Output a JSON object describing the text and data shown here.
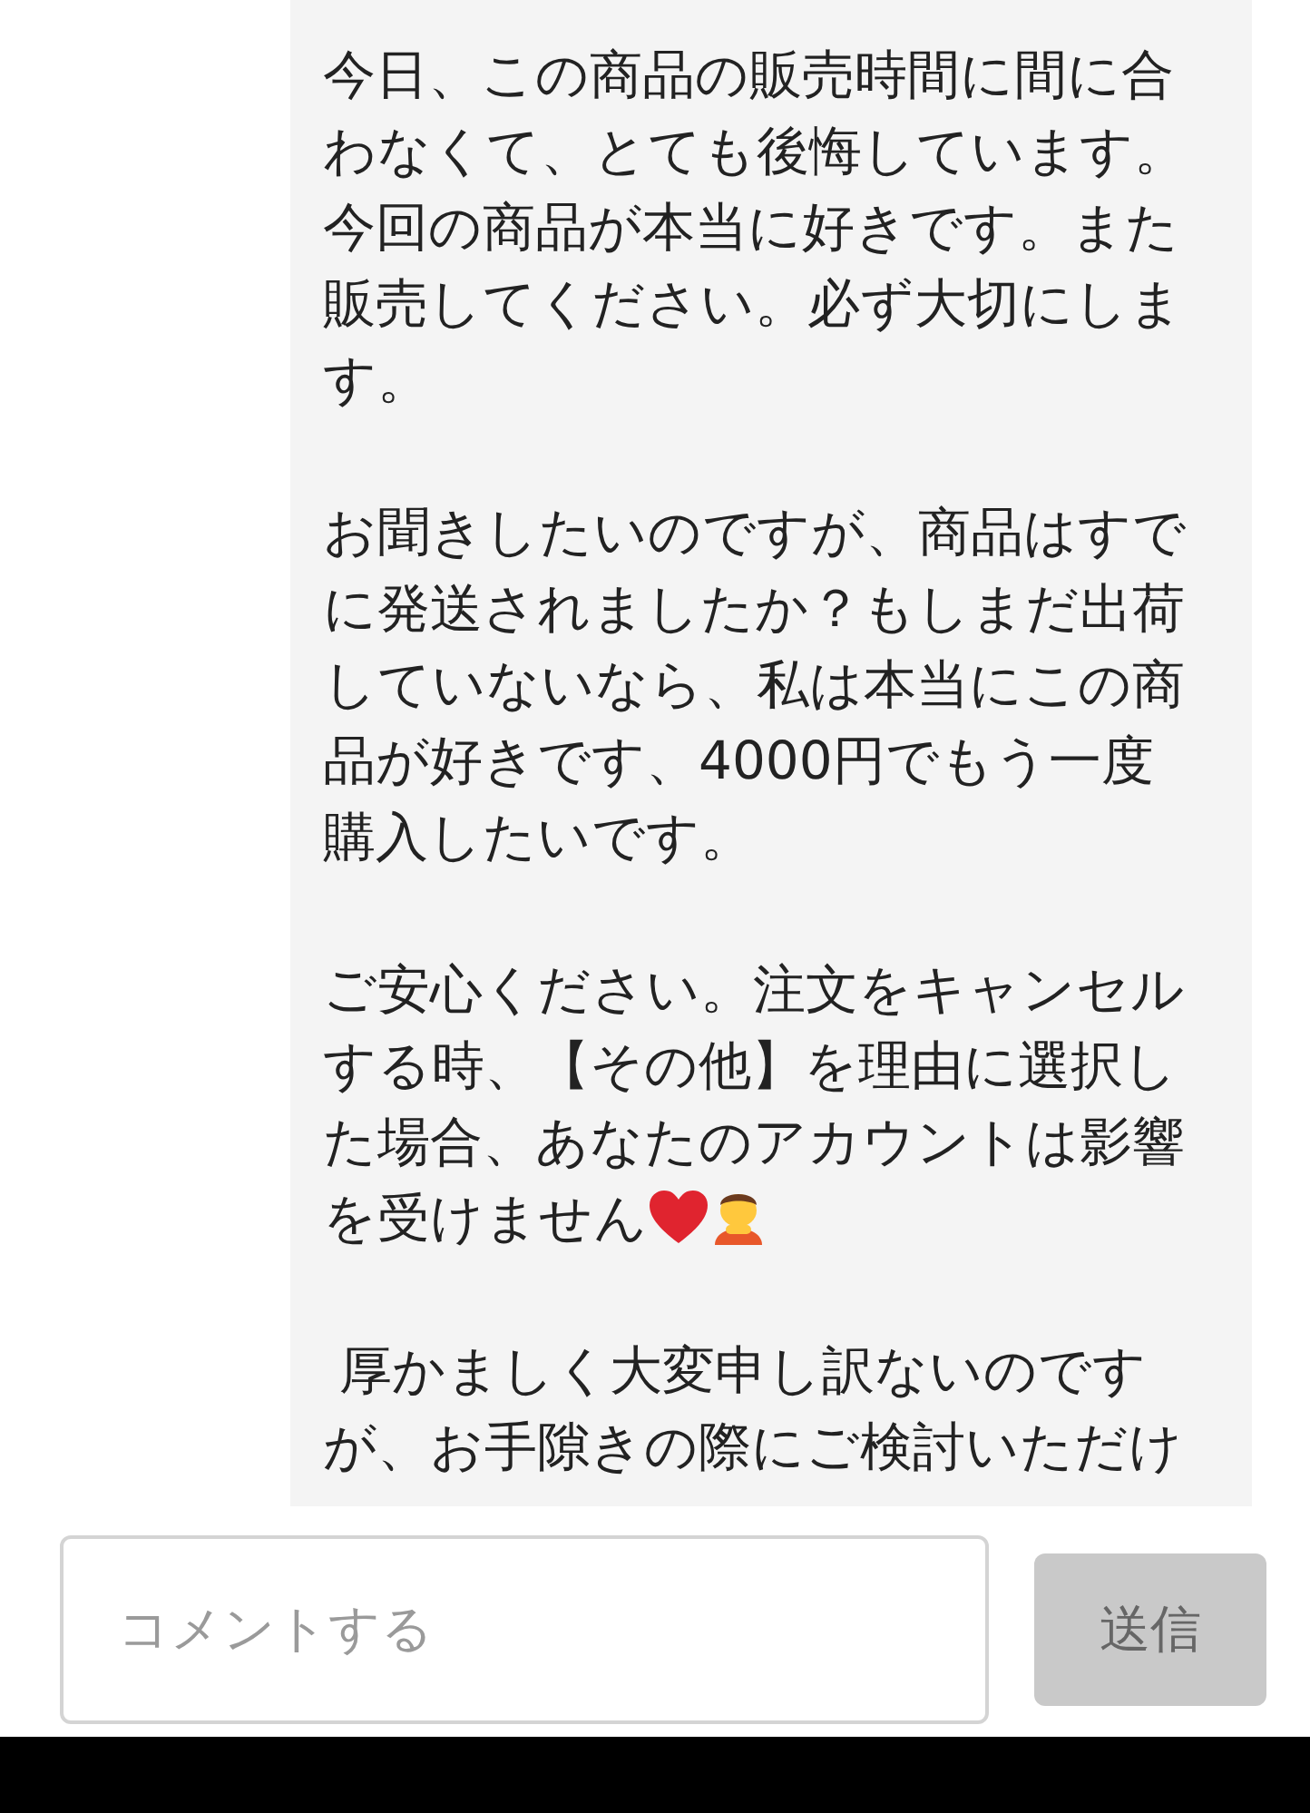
{
  "message": {
    "paragraphs": [
      "今日、この商品の販売時間に間に合わなくて、とても後悔しています。今回の商品が本当に好きです。また販売してください。必ず大切にします。",
      "お聞きしたいのですが、商品はすでに発送されましたか？もしまだ出荷していないなら、私は本当にこの商品が好きです、4000円でもう一度購入したいです。",
      "ご安心ください。注文をキャンセルする時、【その他】を理由に選択した場合、あなたのアカウントは影響を受けません",
      " 厚かましく大変申し訳ないのですが、お手隙きの際にご検討いただけ"
    ]
  },
  "comment": {
    "placeholder": "コメントする",
    "button": "送信"
  }
}
